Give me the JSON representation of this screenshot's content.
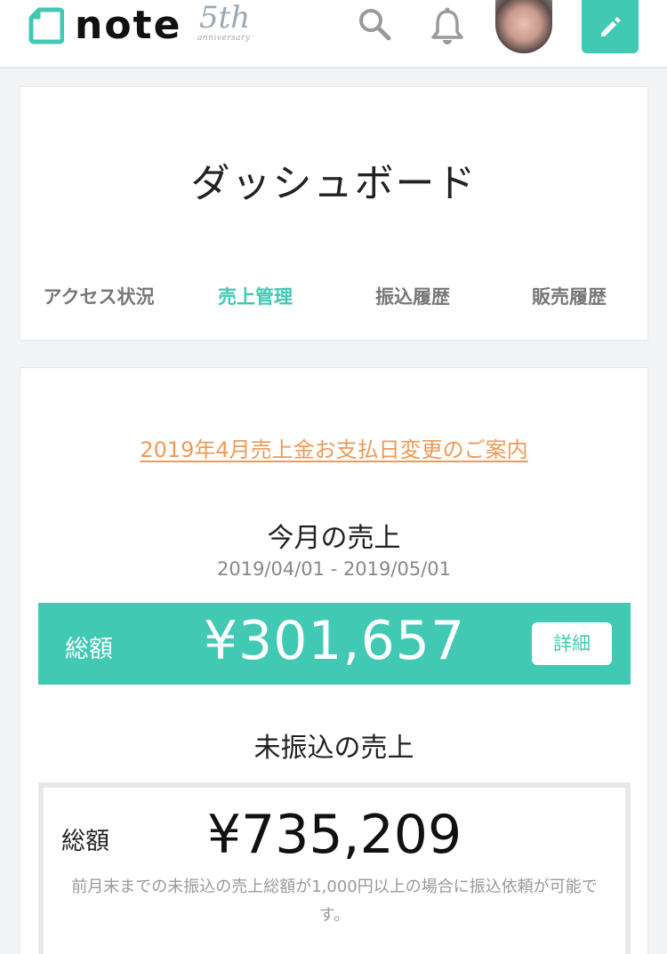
{
  "header": {
    "logo_text": "note",
    "anniversary_number": "5th",
    "anniversary_sub": "anniversary",
    "icons": {
      "logo": "note-logo-icon",
      "search": "search-icon",
      "notifications": "bell-icon",
      "compose": "pencil-icon"
    }
  },
  "dashboard": {
    "title": "ダッシュボード",
    "tabs": [
      {
        "label": "アクセス状況",
        "active": false
      },
      {
        "label": "売上管理",
        "active": true
      },
      {
        "label": "振込履歴",
        "active": false
      },
      {
        "label": "販売履歴",
        "active": false
      }
    ]
  },
  "sales": {
    "notice_link": "2019年4月売上金お支払日変更のご案内",
    "month_title": "今月の売上",
    "period": "2019/04/01 - 2019/05/01",
    "total_label": "総額",
    "total_amount": "¥301,657",
    "detail_button": "詳細",
    "unpaid_title": "未振込の売上",
    "unpaid_label": "総額",
    "unpaid_amount": "¥735,209",
    "unpaid_note": "前月末までの未振込の売上総額が1,000円以上の場合に振込依頼が可能です。"
  },
  "colors": {
    "accent": "#41c9b4",
    "link": "#f09a58",
    "background": "#f2f3f4"
  }
}
